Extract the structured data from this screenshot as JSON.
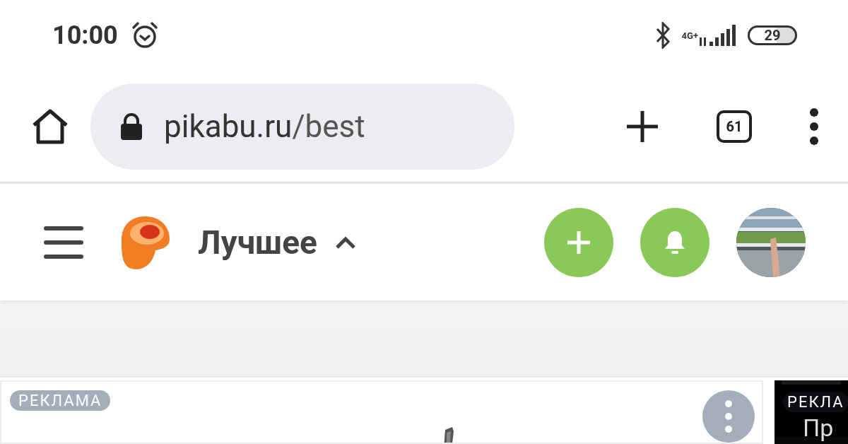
{
  "status_bar": {
    "time": "10:00",
    "network": "4G+",
    "battery": "29"
  },
  "browser_bar": {
    "url_host": "pikabu.ru",
    "url_path": "/best",
    "tab_count": "61"
  },
  "site_header": {
    "title": "Лучшее"
  },
  "feed": {
    "cards": [
      {
        "badge": "РЕКЛАМА",
        "kind": "picture"
      },
      {
        "badge": "РЕКЛА",
        "caption": "Пр",
        "kind": "picture"
      }
    ]
  }
}
